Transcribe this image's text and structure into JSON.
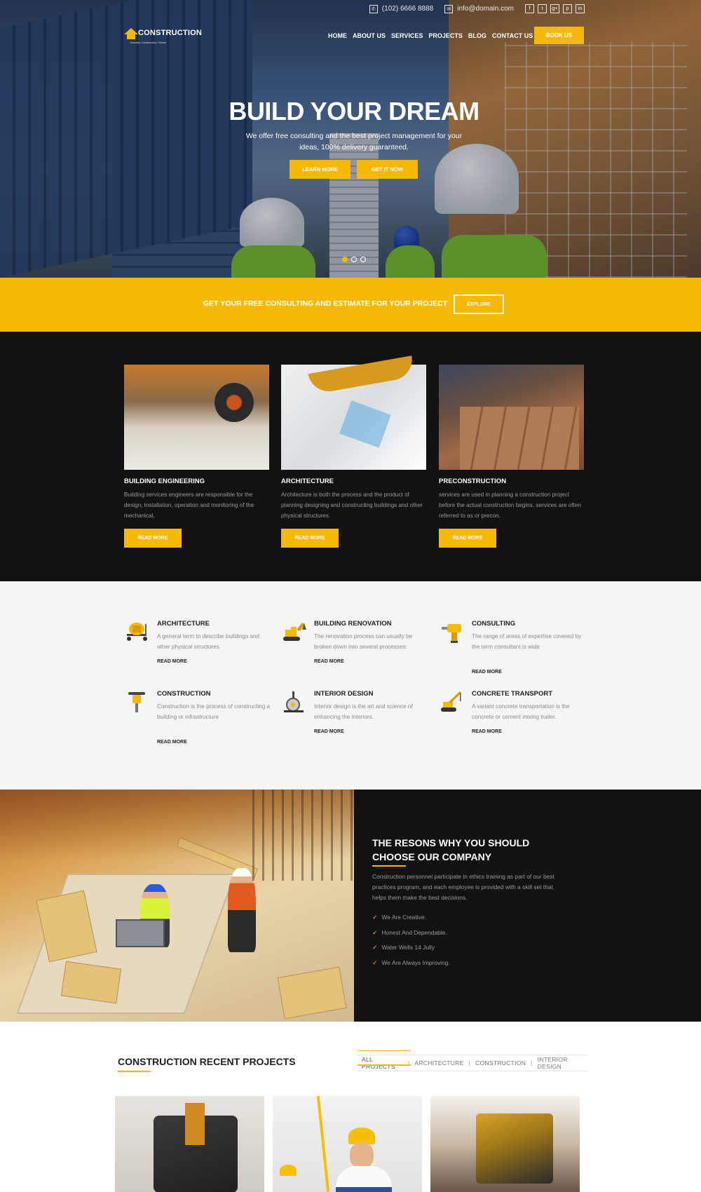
{
  "topbar": {
    "phone": "(102) 6666 8888",
    "email": "info@domain.com",
    "socials": [
      "f",
      "t",
      "g+",
      "p",
      "in"
    ]
  },
  "logo": {
    "name": "CONSTRUCTION",
    "tagline": "Industry Construction Theme"
  },
  "nav": {
    "items": [
      "HOME",
      "ABOUT US",
      "SERVICES",
      "PROJECTS",
      "BLOG",
      "CONTACT US"
    ],
    "book_label": "BOOK US"
  },
  "hero": {
    "title": "BUILD YOUR DREAM",
    "subtitle": "We offer free consulting and the best project management for your ideas, 100% delivery guaranteed.",
    "btn_learn": "LEARN MORE",
    "btn_get": "GET IT NOW",
    "slides": 3,
    "active_slide": 1
  },
  "cta": {
    "text": "GET YOUR FREE CONSULTING AND ESTIMATE FOR YOUR PROJECT",
    "button": "EXPLORE"
  },
  "cards": [
    {
      "title": "BUILDING ENGINEERING",
      "text": "Building services engineers are responsible for the design, installation, operation and monitoring of the mechanical,",
      "button": "READ MORE"
    },
    {
      "title": "ARCHITECTURE",
      "text": "Architecture is both the process and the product of planning designing and constructing buildings and other physical structures.",
      "button": "READ MORE"
    },
    {
      "title": "PRECONSTRUCTION",
      "text": "services are used in planning a construction project before the actual construction begins. services are often referred to as or precon.",
      "button": "READ MORE"
    }
  ],
  "services": [
    {
      "title": "ARCHITECTURE",
      "text": "A general term to describe buildings and other physical structures.",
      "more": "READ MORE",
      "icon": "cement-mixer-icon"
    },
    {
      "title": "BUILDING RENOVATION",
      "text": "The renovation process can usually be broken down into several processes:",
      "more": "READ MORE",
      "icon": "excavator-icon"
    },
    {
      "title": "CONSULTING",
      "text": "The range of areas of expertise covered by the term consultant is wide",
      "more": "READ MORE",
      "icon": "drill-icon"
    },
    {
      "title": "CONSTRUCTION",
      "text": "Construction is the process of constructing a building or infrastructure",
      "more": "READ MORE",
      "icon": "jackhammer-icon"
    },
    {
      "title": "INTERIOR DESIGN",
      "text": "Interior design is the art and science of enhancing the interiors.",
      "more": "READ MORE",
      "icon": "saw-icon"
    },
    {
      "title": "CONCRETE TRANSPORT",
      "text": "A variant concrete transportation is the concrete or cement mixing trailer.",
      "more": "READ MORE",
      "icon": "crane-icon"
    }
  ],
  "why": {
    "title": "THE RESONS WHY YOU SHOULD CHOOSE OUR COMPANY",
    "text": "Construction personnel participate in ethics training as part of our best practices program, and each employee is provided with a skill set that helps them make the best decisions.",
    "list": [
      "We Are Creative.",
      "Honest And Dependable.",
      "Water Wells 14 Jully",
      "We Are Always Improving."
    ]
  },
  "projects": {
    "title": "CONSTRUCTION RECENT PROJECTS",
    "filters": [
      "ALL PROJECTS",
      "ARCHITECTURE",
      "CONSTRUCTION",
      "INTERIOR DESIGN"
    ],
    "active_filter": "ALL PROJECTS"
  },
  "colors": {
    "accent": "#f6b800",
    "dark": "#121212",
    "light": "#f5f5f5"
  }
}
